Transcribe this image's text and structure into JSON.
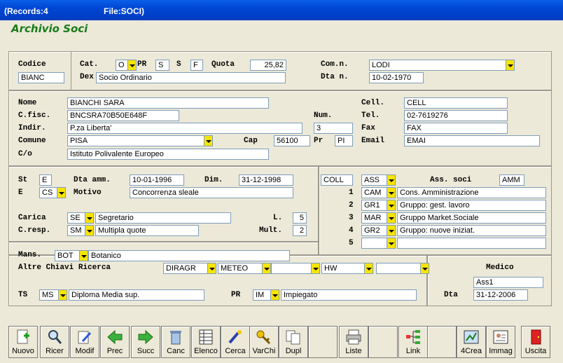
{
  "window": {
    "records": "(Records:4",
    "file": "File:SOCI)"
  },
  "app_title": "Archivio Soci",
  "head": {
    "codice_label": "Codice",
    "codice": "BIANC",
    "cat_label": "Cat.",
    "cat": "O",
    "pr_label": "PR",
    "pr": "S",
    "s_label": "S",
    "sex": "F",
    "quota_label": "Quota",
    "quota": "25,82",
    "dex_label": "Dex",
    "dex": "Socio Ordinario",
    "comn_label": "Com.n.",
    "comn": "LODI",
    "dtan_label": "Dta n.",
    "dtan": "10-02-1970"
  },
  "person": {
    "nome_label": "Nome",
    "nome": "BIANCHI SARA",
    "cfisc_label": "C.fisc.",
    "cfisc": "BNCSRA70B50E648F",
    "indir_label": "Indir.",
    "indir": "P.za Liberta'",
    "num_label": "Num.",
    "num": "3",
    "comune_label": "Comune",
    "comune": "PISA",
    "cap_label": "Cap",
    "cap": "56100",
    "pr_label": "Pr",
    "pr": "PI",
    "co_label": "C/o",
    "co": "Istituto Polivalente Europeo",
    "cell_label": "Cell.",
    "cell": "CELL",
    "tel_label": "Tel.",
    "tel": "02-7619276",
    "fax_label": "Fax",
    "fax": "FAX",
    "email_label": "Email",
    "email": "EMAI"
  },
  "status": {
    "st_label": "St",
    "st": "E",
    "dtaamm_label": "Dta amm.",
    "dtaamm": "10-01-1996",
    "dim_label": "Dim.",
    "dim": "31-12-1998",
    "e_label": "E",
    "e": "CS",
    "motivo_label": "Motivo",
    "motivo": "Concorrenza sleale",
    "carica_label": "Carica",
    "carica_code": "SE",
    "carica": "Segretario",
    "l_label": "L.",
    "l": "5",
    "cresp_label": "C.resp.",
    "cresp_code": "SM",
    "cresp": "Multipla quote",
    "mult_label": "Mult.",
    "mult": "2"
  },
  "assoc": {
    "coll": "COLL",
    "ass": "ASS",
    "label": "Ass. soci",
    "amm": "AMM",
    "rows": [
      {
        "n": "1",
        "code": "CAM",
        "desc": "Cons. Amministrazione"
      },
      {
        "n": "2",
        "code": "GR1",
        "desc": "Gruppo: gest. lavoro"
      },
      {
        "n": "3",
        "code": "MAR",
        "desc": "Gruppo Market.Sociale"
      },
      {
        "n": "4",
        "code": "GR2",
        "desc": "Gruppo: nuove iniziat."
      },
      {
        "n": "5",
        "code": "",
        "desc": ""
      }
    ]
  },
  "bottom": {
    "mans_label": "Mans.",
    "mans_code": "BOT",
    "mans": "Botanico",
    "altre_label": "Altre Chiavi Ricerca",
    "key1": "DIRAGR",
    "key2": "METEO",
    "key3": "",
    "key4": "HW",
    "key5": "",
    "ts_label": "TS",
    "ts_code": "MS",
    "ts": "Diploma Media sup.",
    "pr_label": "PR",
    "pr_code": "IM",
    "pr": "Impiegato",
    "medico_label": "Medico",
    "medico": "Ass1",
    "dta_label": "Dta",
    "dta": "31-12-2006"
  },
  "toolbar": [
    "Nuovo",
    "Ricer",
    "Modif",
    "Prec",
    "Succ",
    "Canc",
    "Elenco",
    "Cerca",
    "VarChi",
    "Dupl",
    "",
    "Liste",
    "",
    "Link",
    "",
    "4Crea",
    "Immag",
    "",
    "Uscita"
  ]
}
